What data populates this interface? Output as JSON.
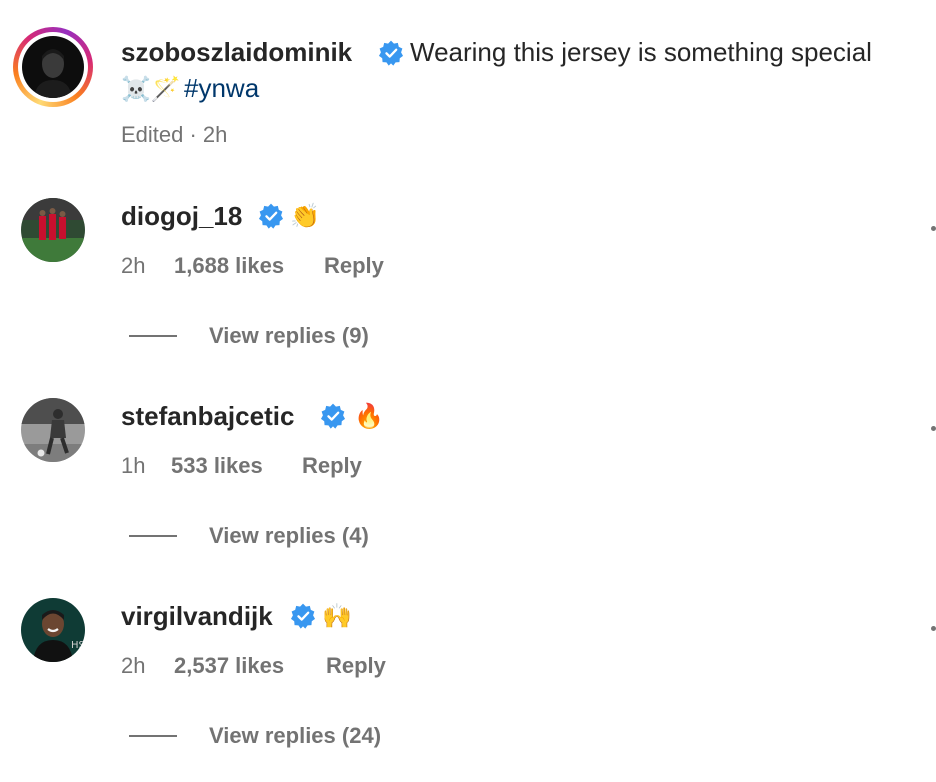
{
  "post": {
    "username": "szoboszlaidominik",
    "caption": "Wearing this jersey is something special",
    "caption_emoji": "☠️🪄",
    "hashtag": "#ynwa",
    "edited_label": "Edited · 2h",
    "verified": true
  },
  "comments": [
    {
      "username": "diogoj_18",
      "emoji": "👏",
      "time": "2h",
      "likes": "1,688 likes",
      "reply_label": "Reply",
      "view_replies": "View replies (9)",
      "verified": true
    },
    {
      "username": "stefanbajcetic",
      "emoji": "🔥",
      "time": "1h",
      "likes": "533 likes",
      "reply_label": "Reply",
      "view_replies": "View replies (4)",
      "verified": true
    },
    {
      "username": "virgilvandijk",
      "emoji": "🙌",
      "time": "2h",
      "likes": "2,537 likes",
      "reply_label": "Reply",
      "view_replies": "View replies (24)",
      "verified": true
    }
  ],
  "colors": {
    "verified_badge": "#3897f0",
    "hashtag": "#00376b",
    "secondary_text": "#737373"
  },
  "icons": [
    "verified-badge-icon",
    "story-ring"
  ]
}
